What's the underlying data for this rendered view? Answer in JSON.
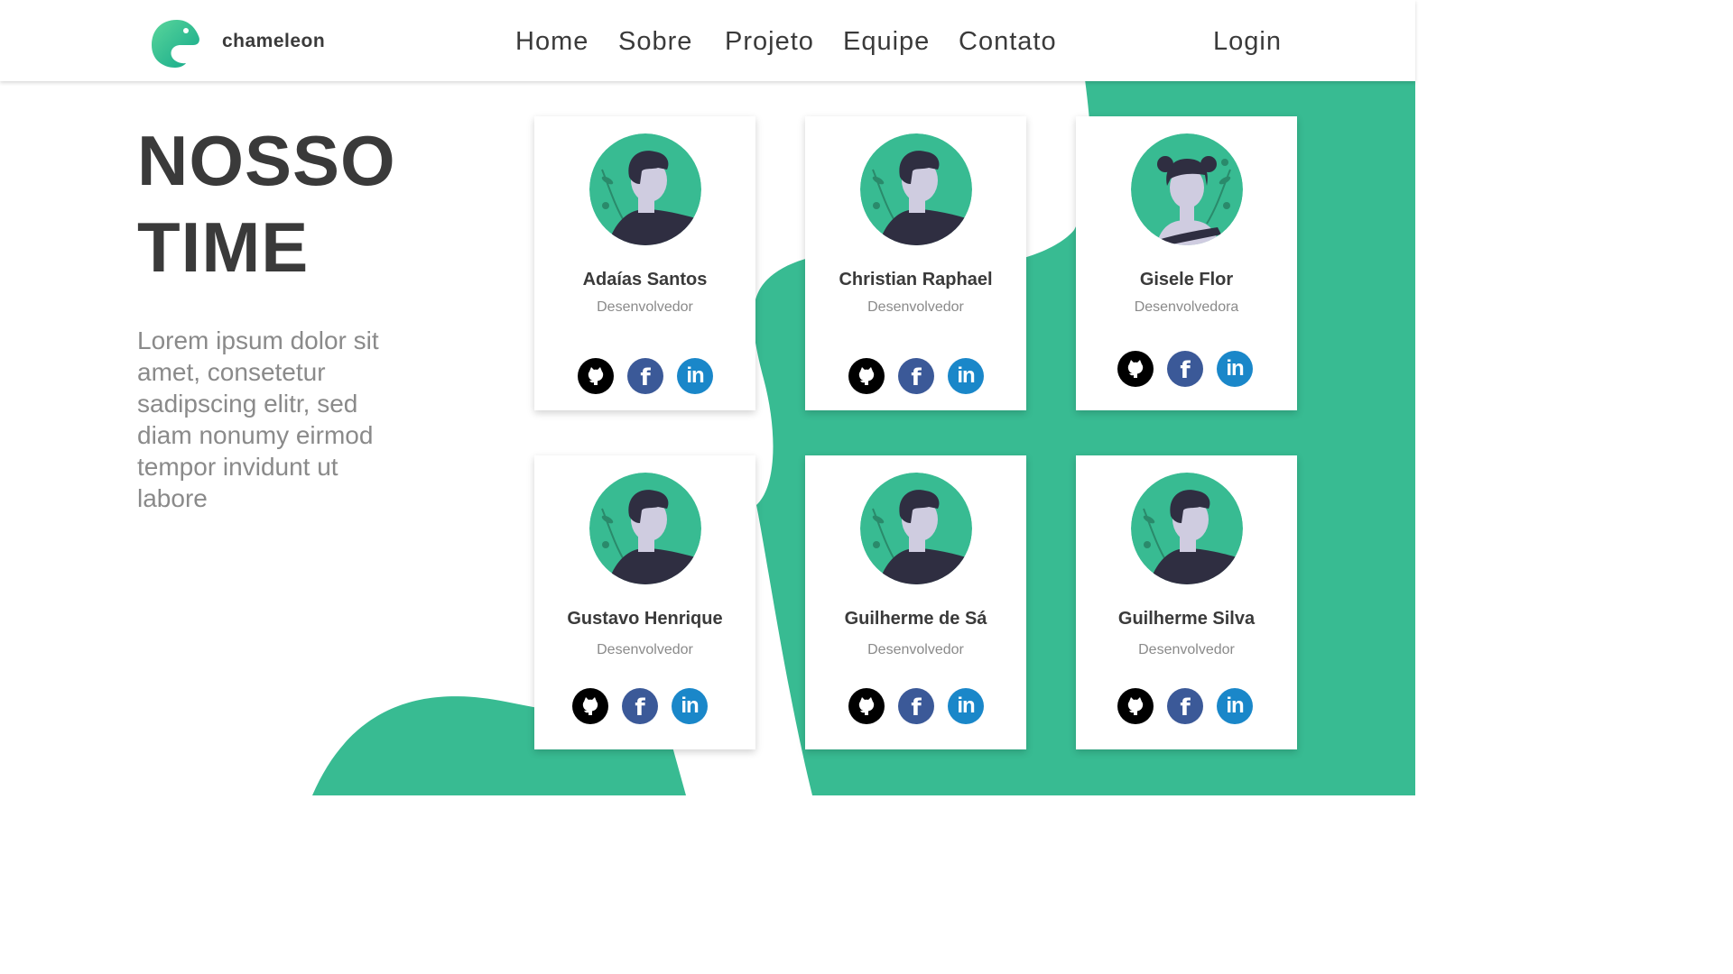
{
  "brand": {
    "name": "chameleon",
    "logo_icon": "chameleon-logo-icon"
  },
  "nav": {
    "items": [
      {
        "label": "Home"
      },
      {
        "label": "Sobre"
      },
      {
        "label": "Projeto"
      },
      {
        "label": "Equipe"
      },
      {
        "label": "Contato"
      }
    ],
    "login": "Login"
  },
  "hero": {
    "title_line1": "NOSSO",
    "title_line2": "TIME",
    "description": "Lorem ipsum dolor sit amet, consetetur sadipscing elitr, sed diam nonumy eirmod tempor invidunt ut labore"
  },
  "team": [
    {
      "name": "Adaías Santos",
      "role": "Desenvolvedor"
    },
    {
      "name": "Christian Raphael",
      "role": "Desenvolvedor"
    },
    {
      "name": "Gisele Flor",
      "role": "Desenvolvedora"
    },
    {
      "name": "Gustavo Henrique",
      "role": "Desenvolvedor"
    },
    {
      "name": "Guilherme de Sá",
      "role": "Desenvolvedor"
    },
    {
      "name": "Guilherme Silva",
      "role": "Desenvolvedor"
    }
  ],
  "social": {
    "facebook_glyph": "f",
    "linkedin_glyph": "in",
    "icons": [
      "github-icon",
      "facebook-icon",
      "linkedin-icon"
    ]
  },
  "colors": {
    "accent": "#38bb92",
    "text": "#3a3a3a",
    "muted": "#8a8a8a",
    "facebook": "#3b5998",
    "linkedin": "#1a87c9"
  }
}
